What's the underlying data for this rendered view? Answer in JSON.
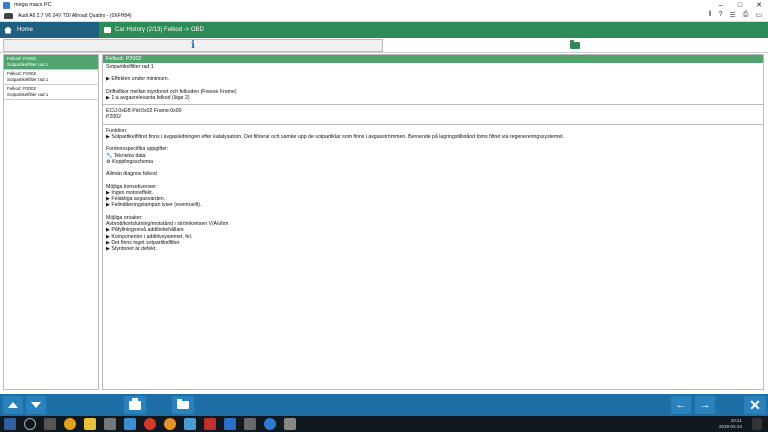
{
  "window": {
    "title": "mega macs PC"
  },
  "vehicle": {
    "label": "Audi A6 2.7 V6 24V TDI Allroad Quattro - (0XFH84)"
  },
  "nav": {
    "home_label": "Home",
    "breadcrumb": "Car History (2/13) Felkod -> OBD"
  },
  "tabs": {
    "info_glyph": "i"
  },
  "list": {
    "items": [
      {
        "line1": "Felkod: P2002",
        "line2": "Sotpartikelfilter rad 1",
        "selected": true
      },
      {
        "line1": "Felkod: P2002",
        "line2": "Sotpartikelfilter rad 1",
        "selected": false
      },
      {
        "line1": "Felkod: P2002",
        "line2": "Sotpartikelfilter rad 1",
        "selected": false
      }
    ]
  },
  "detail": {
    "header": "Felkod: P2002",
    "name": "Sotpartikelfilter rad 1",
    "effect": "▶ Effekten under minimum.",
    "freeze_title": "Driftvillkor mellan styrdonet och felkoden (Freeze Frame)",
    "freeze_item": "▶ 1:a avgasrelevanta felkod (läge 2)",
    "ecu_line": "ECU:0xEB Pid:0x02 Frame:0x00",
    "ecu_code": "P2002",
    "funktion_title": "Funktion:",
    "funktion_text": "▶ Sotpartikelfiltret finns i avgasledningen efter katalysatorn. Det filtrerar och samlar upp de sotpartiklar som finns i avgasströmmen. Beroende på lagringstillstånd töms filtret via regenereringssystemet.",
    "specific_title": "Fordonsspecifika uppgifter:",
    "specific_1": "Tekniska data",
    "specific_2": "Kopplingsschema",
    "general": "Allmän diagnos felkod",
    "cons_title": "Möjliga konsekvenser:",
    "cons_1": "▶ Ingen motoreffekt.",
    "cons_2": "▶ Felaktiga avgasvärden.",
    "cons_3": "▶ Felindikeringslampan lyser (eventuellt).",
    "causes_title": "Möjliga orsaker:",
    "causes_0": "Avbrott/kortslutning/motstånd i strömkretsen V/A/ohm",
    "causes_1": "▶ Påfyllningsnivå additivbehållare",
    "causes_2": "▶ Komponenter i additivsystemet, fel.",
    "causes_3": "▶ Det finns inget sotpartikelfilter.",
    "causes_4": "▶ Styrdonet är defekt."
  },
  "taskbar": {
    "time": "10:21",
    "date": "2019-01-24"
  },
  "colors": {
    "green": "#2e8b57",
    "blue": "#1e6fa6",
    "selected": "#52a46e"
  }
}
